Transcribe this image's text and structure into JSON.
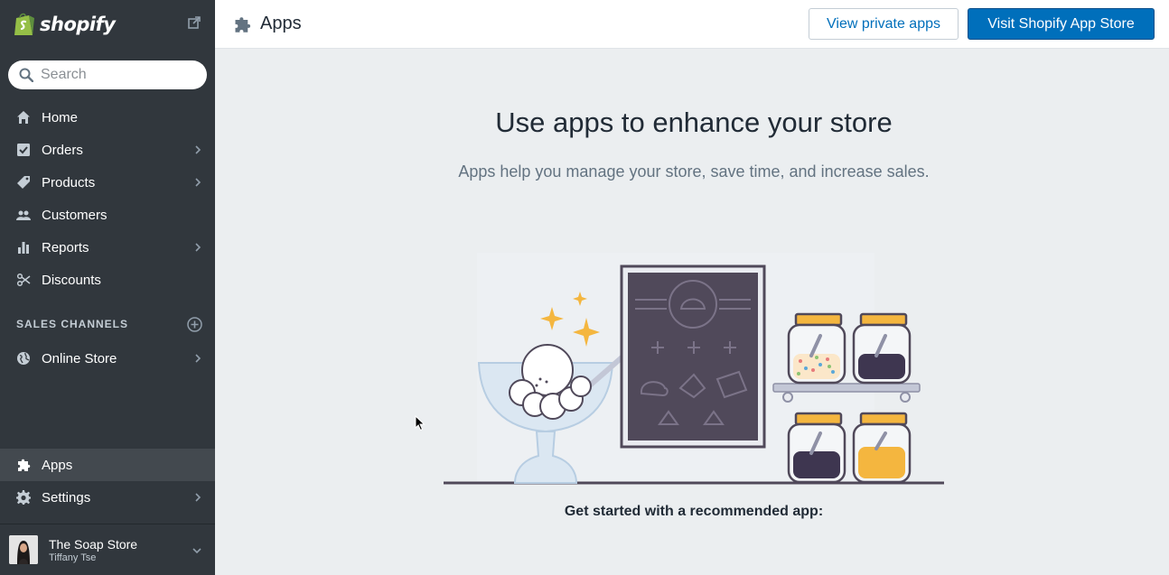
{
  "brand": {
    "name": "shopify"
  },
  "search": {
    "placeholder": "Search"
  },
  "sidebar": {
    "items": [
      {
        "label": "Home",
        "icon": "home-icon"
      },
      {
        "label": "Orders",
        "icon": "orders-icon"
      },
      {
        "label": "Products",
        "icon": "tag-icon"
      },
      {
        "label": "Customers",
        "icon": "customers-icon"
      },
      {
        "label": "Reports",
        "icon": "bar-chart-icon"
      },
      {
        "label": "Discounts",
        "icon": "discount-icon"
      }
    ],
    "sales_channels_heading": "SALES CHANNELS",
    "channels": [
      {
        "label": "Online Store",
        "icon": "globe-icon"
      }
    ],
    "bottom_items": [
      {
        "label": "Apps",
        "icon": "puzzle-icon",
        "active": true
      },
      {
        "label": "Settings",
        "icon": "gear-icon"
      }
    ],
    "store": {
      "name": "The Soap Store",
      "user": "Tiffany Tse"
    }
  },
  "header": {
    "title": "Apps",
    "view_private_label": "View private apps",
    "visit_store_label": "Visit Shopify App Store"
  },
  "main": {
    "heading": "Use apps to enhance your store",
    "subheading": "Apps help you manage your store, save time, and increase sales.",
    "get_started": "Get started with a recommended app:"
  },
  "colors": {
    "sidebar_bg": "#31373d",
    "primary_button": "#006fbb",
    "page_bg": "#ebeef0",
    "illustration_purple": "#50495a",
    "illustration_gold": "#f4b63f"
  }
}
